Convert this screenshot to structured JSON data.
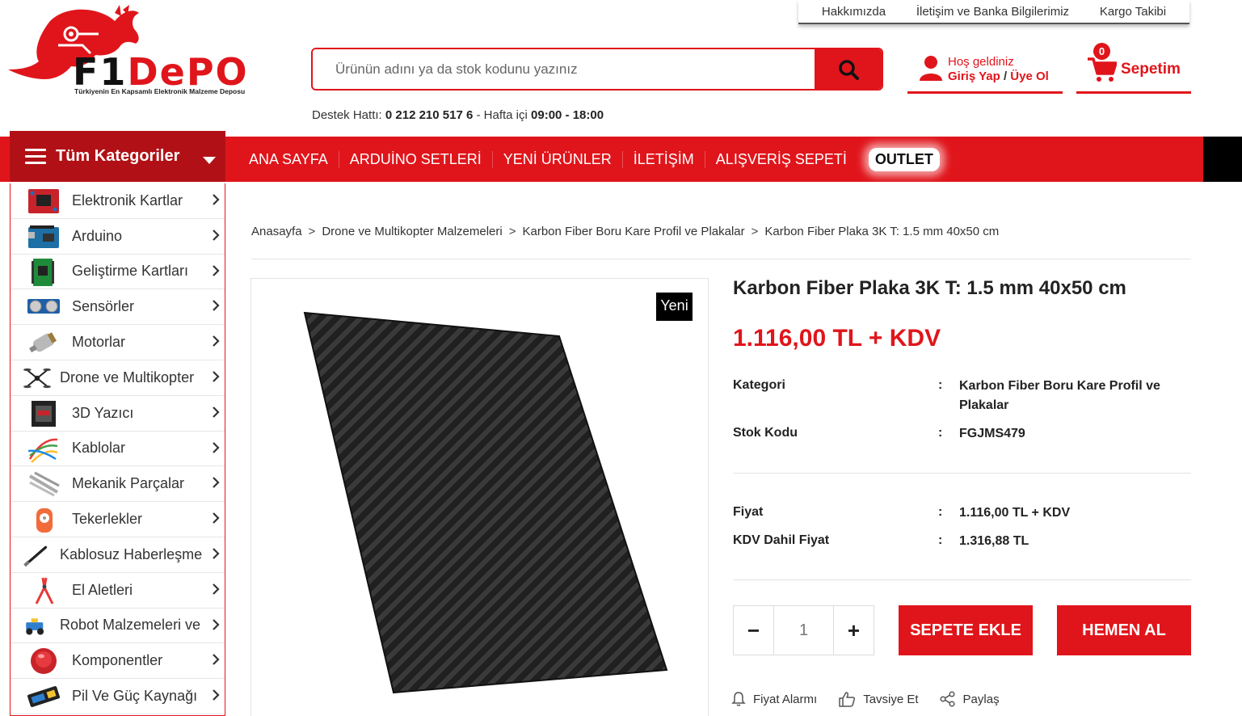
{
  "top_links": [
    "Hakkımızda",
    "İletişim ve Banka Bilgilerimiz",
    "Kargo Takibi"
  ],
  "logo": {
    "brand_f1": "F1",
    "brand_depo": "DePO",
    "tagline": "Türkiyenin En Kapsamlı Elektronik Malzeme Deposu"
  },
  "search": {
    "placeholder": "Ürünün adını ya da stok kodunu yazınız"
  },
  "support": {
    "label": "Destek Hattı:",
    "phone": "0 212 210 517 6",
    "sep": "-",
    "hours_label": "Hafta içi",
    "hours": "09:00 - 18:00"
  },
  "account": {
    "greeting": "Hoş geldiniz",
    "login": "Giriş Yap",
    "slash": "/",
    "register": "Üye Ol"
  },
  "cart": {
    "count": "0",
    "label": "Sepetim"
  },
  "all_categories": "Tüm Kategoriler",
  "nav": [
    "ANA SAYFA",
    "ARDUİNO SETLERİ",
    "YENİ ÜRÜNLER",
    "İLETİŞİM",
    "ALIŞVERİŞ SEPETİ",
    "OUTLET"
  ],
  "categories": [
    "Elektronik Kartlar",
    "Arduino",
    "Geliştirme Kartları",
    "Sensörler",
    "Motorlar",
    "Drone ve Multikopter",
    "3D Yazıcı",
    "Kablolar",
    "Mekanik Parçalar",
    "Tekerlekler",
    "Kablosuz Haberleşme",
    "El Aletleri",
    "Robot Malzemeleri ve",
    "Komponentler",
    "Pil Ve Güç Kaynağı"
  ],
  "breadcrumb": [
    "Anasayfa",
    "Drone ve Multikopter Malzemeleri",
    "Karbon Fiber Boru Kare Profil ve Plakalar",
    "Karbon Fiber Plaka 3K T: 1.5 mm 40x50 cm"
  ],
  "breadcrumb_sep": ">",
  "product": {
    "badge": "Yeni",
    "title": "Karbon Fiber Plaka 3K T: 1.5 mm 40x50 cm",
    "price": "1.116,00 TL + KDV",
    "colon": ":",
    "category_label": "Kategori",
    "category_value": "Karbon Fiber Boru Kare Profil ve Plakalar",
    "sku_label": "Stok Kodu",
    "sku_value": "FGJMS479",
    "price_label": "Fiyat",
    "price_value": "1.116,00 TL + KDV",
    "vat_price_label": "KDV Dahil Fiyat",
    "vat_price_value": "1.316,88 TL",
    "quantity": "1",
    "minus": "−",
    "plus": "+",
    "add_to_cart": "SEPETE EKLE",
    "buy_now": "HEMEN AL",
    "price_alarm": "Fiyat Alarmı",
    "recommend": "Tavsiye Et",
    "share": "Paylaş"
  },
  "colors": {
    "brand_red": "#e0151b",
    "dark_red": "#b11116",
    "text": "#222222"
  }
}
